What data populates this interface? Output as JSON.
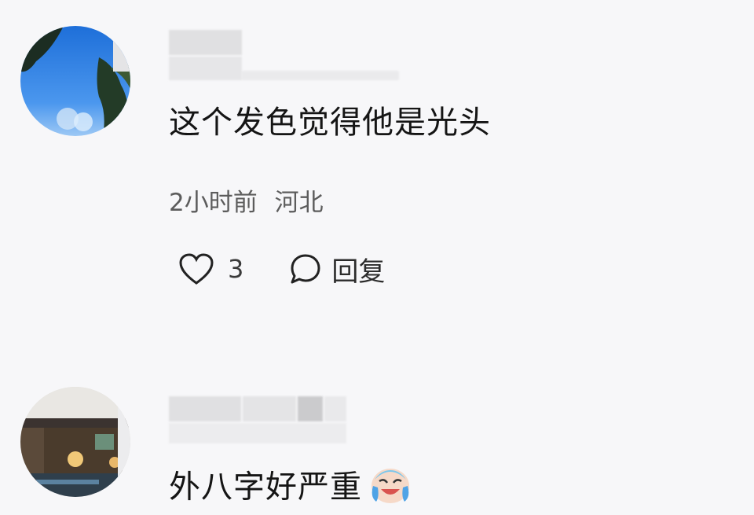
{
  "comments": [
    {
      "text": "这个发色觉得他是光头",
      "time": "2小时前",
      "location": "河北",
      "like_count": "3",
      "reply_label": "回复",
      "avatar_icon": "sky-tree-avatar"
    },
    {
      "text": "外八字好严重",
      "emoji_icon": "crying-laughing-emoji",
      "avatar_icon": "house-interior-avatar"
    }
  ],
  "colors": {
    "background": "#f7f7f9",
    "text": "#151515",
    "meta": "#5c5c5c"
  }
}
